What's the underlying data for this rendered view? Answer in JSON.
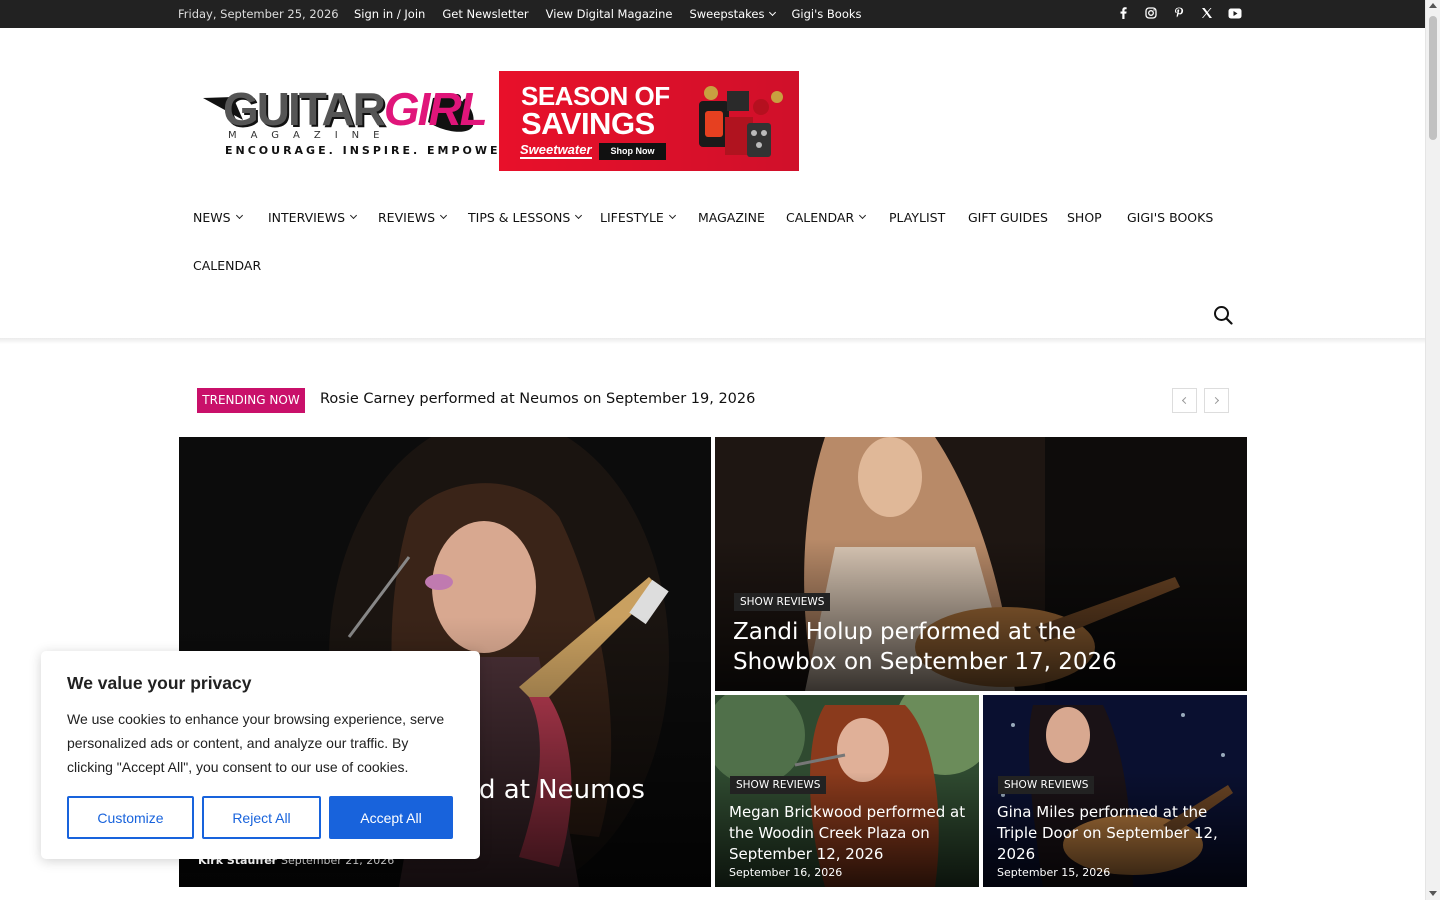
{
  "topbar": {
    "date": "Friday, September 25, 2026",
    "links": [
      "Sign in / Join",
      "Get Newsletter",
      "View Digital Magazine",
      "Sweepstakes",
      "Gigi's Books"
    ],
    "social": [
      "facebook-icon",
      "instagram-icon",
      "pinterest-icon",
      "x-icon",
      "youtube-icon"
    ]
  },
  "logo": {
    "word1": "GUITAR",
    "word2": "GIRL",
    "sub1": "MAGAZINE",
    "sub2": "ENCOURAGE. INSPIRE. EMPOWER."
  },
  "ad": {
    "line1": "SEASON OF",
    "line2": "SAVINGS",
    "brand": "Sweetwater",
    "cta": "Shop Now"
  },
  "nav": {
    "items": [
      "NEWS",
      "INTERVIEWS",
      "REVIEWS",
      "TIPS & LESSONS",
      "LIFESTYLE",
      "MAGAZINE",
      "CALENDAR",
      "PLAYLIST",
      "GIFT GUIDES",
      "SHOP",
      "GIGI'S BOOKS",
      "CALENDAR"
    ]
  },
  "trending": {
    "badge": "TRENDING NOW",
    "headline": "Rosie Carney performed at Neumos on September 19, 2026"
  },
  "tiles": {
    "main": {
      "title_visible": "d at Neumos",
      "author": "Kirk Stauffer",
      "date": "September 21, 2026"
    },
    "top_right": {
      "category": "SHOW REVIEWS",
      "title": "Zandi Holup performed at the Showbox on September 17, 2026"
    },
    "bottom_left": {
      "category": "SHOW REVIEWS",
      "title": "Megan Brickwood performed at the Woodin Creek Plaza on September 12, 2026",
      "date": "September 16, 2026"
    },
    "bottom_right": {
      "category": "SHOW REVIEWS",
      "title": "Gina Miles performed at the Triple Door on September 12, 2026",
      "date": "September 15, 2026"
    }
  },
  "cookie": {
    "title": "We value your privacy",
    "text": "We use cookies to enhance your browsing experience, serve personalized ads or content, and analyze our traffic. By clicking \"Accept All\", you consent to our use of cookies.",
    "customize": "Customize",
    "reject": "Reject All",
    "accept": "Accept All"
  },
  "colors": {
    "accent": "#c9106a",
    "topbar": "#222222",
    "cookie_button": "#1863dc",
    "ad_red": "#e8102a"
  }
}
